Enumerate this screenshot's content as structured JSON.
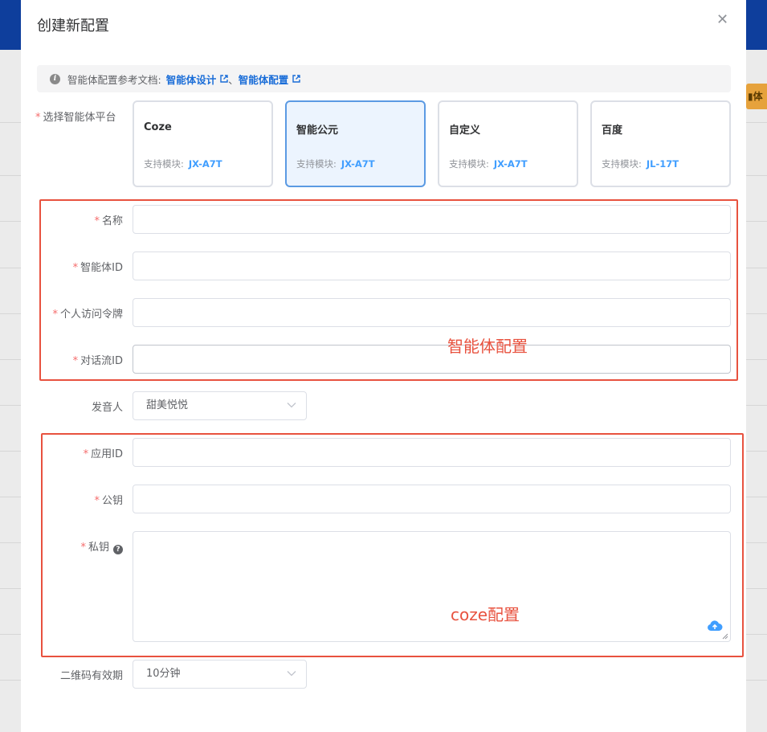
{
  "modal": {
    "title": "创建新配置",
    "close_icon": "close-icon"
  },
  "background": {
    "badge_text": "体",
    "header_color": "#0e3e9c",
    "badge_color": "#e6a23c"
  },
  "notice": {
    "prefix": "智能体配置参考文档:",
    "link1": "智能体设计",
    "separator": "、",
    "link2": "智能体配置",
    "icon": "info-icon"
  },
  "form": {
    "platform_label": "选择智能体平台",
    "platforms": [
      {
        "name": "Coze",
        "module_label": "支持模块:",
        "module_value": "JX-A7T",
        "selected": false
      },
      {
        "name": "智能公元",
        "module_label": "支持模块:",
        "module_value": "JX-A7T",
        "selected": true
      },
      {
        "name": "自定义",
        "module_label": "支持模块:",
        "module_value": "JX-A7T",
        "selected": false
      },
      {
        "name": "百度",
        "module_label": "支持模块:",
        "module_value": "JL-17T",
        "selected": false
      }
    ],
    "name_label": "名称",
    "agent_id_label": "智能体ID",
    "token_label": "个人访问令牌",
    "flow_id_label": "对话流ID",
    "voice_label": "发音人",
    "voice_value": "甜美悦悦",
    "app_id_label": "应用ID",
    "public_key_label": "公钥",
    "private_key_label": "私钥",
    "qr_label": "二维码有效期",
    "qr_value": "10分钟",
    "required_mark": "*"
  },
  "annotations": {
    "agent_config": "智能体配置",
    "coze_config": "coze配置",
    "color": "#e8523f"
  }
}
